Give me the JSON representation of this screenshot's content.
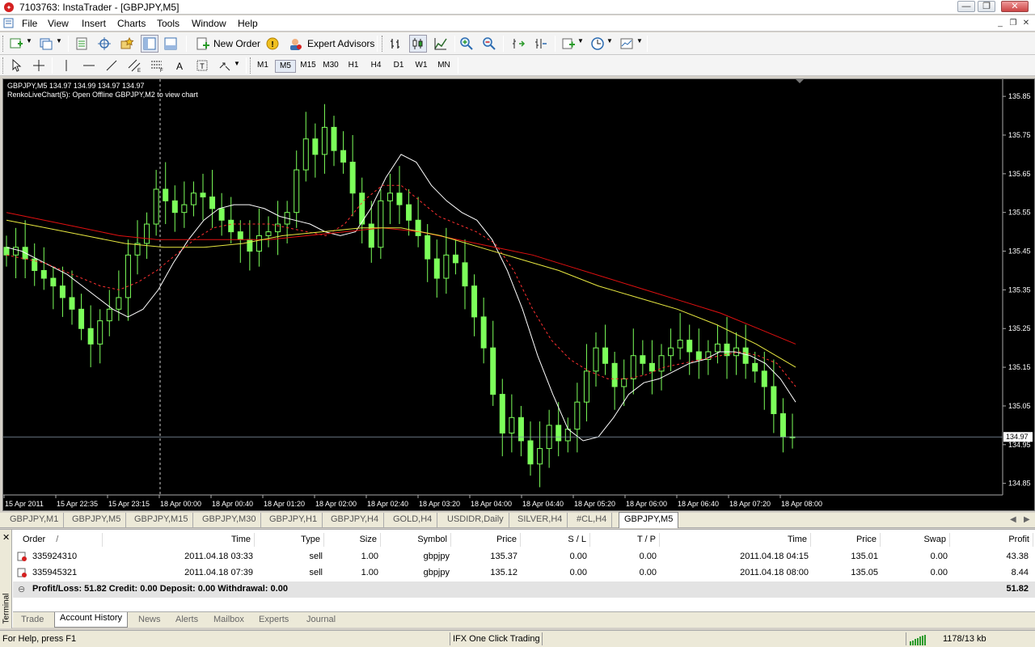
{
  "window": {
    "title": "7103763: InstaTrader - [GBPJPY,M5]",
    "min_label": "—",
    "max_label": "❐",
    "close_label": "✕"
  },
  "menu": [
    "File",
    "View",
    "Insert",
    "Charts",
    "Tools",
    "Window",
    "Help"
  ],
  "toolbar": {
    "new_order": "New Order",
    "expert_advisors": "Expert Advisors",
    "timeframes": [
      "M1",
      "M5",
      "M15",
      "M30",
      "H1",
      "H4",
      "D1",
      "W1",
      "MN"
    ]
  },
  "chart": {
    "header_line1": "GBPJPY,M5  134.97 134.99 134.97 134.97",
    "header_line2": "RenkoLiveChart(5): Open Offline GBPJPY,M2 to view chart",
    "current_price": "134.97",
    "colors": {
      "background": "#000000",
      "candle": "#7cff5a",
      "grid": "#ffffff",
      "ma_fast": "#ffffff",
      "ma_dash": "#ff3030",
      "ma_slow_red": "#e01010",
      "ma_slow_yellow": "#e8e840"
    }
  },
  "chart_data": {
    "type": "line",
    "symbol": "GBPJPY",
    "timeframe": "M5",
    "y_ticks": [
      "135.85",
      "135.75",
      "135.65",
      "135.55",
      "135.45",
      "135.35",
      "135.25",
      "135.15",
      "135.05",
      "134.95",
      "134.85"
    ],
    "x_ticks": [
      "15 Apr 2011",
      "15 Apr 22:35",
      "15 Apr 23:15",
      "18 Apr 00:00",
      "18 Apr 00:40",
      "18 Apr 01:20",
      "18 Apr 02:00",
      "18 Apr 02:40",
      "18 Apr 03:20",
      "18 Apr 04:00",
      "18 Apr 04:40",
      "18 Apr 05:20",
      "18 Apr 06:00",
      "18 Apr 06:40",
      "18 Apr 07:20",
      "18 Apr 08:00"
    ],
    "ylim": [
      134.82,
      135.89
    ],
    "close_series": [
      135.44,
      135.46,
      135.43,
      135.4,
      135.38,
      135.36,
      135.33,
      135.3,
      135.25,
      135.21,
      135.27,
      135.3,
      135.33,
      135.44,
      135.47,
      135.52,
      135.61,
      135.58,
      135.55,
      135.57,
      135.6,
      135.59,
      135.56,
      135.53,
      135.5,
      135.48,
      135.45,
      135.49,
      135.5,
      135.52,
      135.55,
      135.66,
      135.74,
      135.7,
      135.77,
      135.71,
      135.68,
      135.6,
      135.52,
      135.46,
      135.58,
      135.6,
      135.57,
      135.53,
      135.49,
      135.43,
      135.38,
      135.44,
      135.42,
      135.36,
      135.28,
      135.2,
      135.08,
      134.98,
      135.02,
      134.96,
      134.9,
      134.94,
      135.0,
      134.96,
      134.99,
      135.06,
      135.14,
      135.2,
      135.16,
      135.1,
      135.12,
      135.18,
      135.16,
      135.14,
      135.18,
      135.2,
      135.22,
      135.19,
      135.17,
      135.19,
      135.21,
      135.18,
      135.2,
      135.16,
      135.14,
      135.1,
      135.03,
      134.97,
      134.97
    ],
    "series": [
      {
        "name": "MA fast",
        "values": [
          135.46,
          135.45,
          135.43,
          135.41,
          135.39,
          135.36,
          135.33,
          135.3,
          135.28,
          135.3,
          135.35,
          135.42,
          135.48,
          135.53,
          135.56,
          135.57,
          135.57,
          135.56,
          135.54,
          135.53,
          135.52,
          135.5,
          135.49,
          135.5,
          135.56,
          135.64,
          135.7,
          135.68,
          135.62,
          135.58,
          135.55,
          135.53,
          135.48,
          135.4,
          135.3,
          135.18,
          135.08,
          134.99,
          134.96,
          134.97,
          135.02,
          135.08,
          135.11,
          135.12,
          135.14,
          135.16,
          135.17,
          135.19,
          135.19,
          135.18,
          135.16,
          135.12,
          135.06
        ]
      },
      {
        "name": "MA dashed",
        "values": [
          135.44,
          135.43,
          135.42,
          135.4,
          135.38,
          135.36,
          135.35,
          135.37,
          135.4,
          135.44,
          135.48,
          135.51,
          135.52,
          135.52,
          135.52,
          135.51,
          135.5,
          135.49,
          135.52,
          135.58,
          135.62,
          135.62,
          135.58,
          135.54,
          135.52,
          135.5,
          135.47,
          135.4,
          135.3,
          135.22,
          135.17,
          135.14,
          135.12,
          135.12,
          135.13,
          135.15,
          135.16,
          135.17,
          135.18,
          135.19,
          135.18,
          135.16,
          135.1
        ]
      },
      {
        "name": "MA slow red",
        "values": [
          135.55,
          135.53,
          135.51,
          135.49,
          135.48,
          135.48,
          135.48,
          135.48,
          135.49,
          135.5,
          135.51,
          135.5,
          135.48,
          135.46,
          135.44,
          135.41,
          135.38,
          135.35,
          135.32,
          135.29,
          135.25,
          135.21
        ]
      },
      {
        "name": "MA slow yellow",
        "values": [
          135.53,
          135.51,
          135.49,
          135.47,
          135.46,
          135.46,
          135.47,
          135.49,
          135.5,
          135.51,
          135.51,
          135.49,
          135.46,
          135.43,
          135.4,
          135.36,
          135.33,
          135.3,
          135.26,
          135.21,
          135.15
        ]
      }
    ]
  },
  "symbol_tabs": [
    "GBPJPY,M1",
    "GBPJPY,M5",
    "GBPJPY,M15",
    "GBPJPY,M30",
    "GBPJPY,H1",
    "GBPJPY,H4",
    "GOLD,H4",
    "USDIDR,Daily",
    "SILVER,H4",
    "#CL,H4",
    "GBPJPY,M5"
  ],
  "terminal": {
    "side_label": "Terminal",
    "close_label": "✕",
    "columns": [
      "Order",
      "/",
      "Time",
      "Type",
      "Size",
      "Symbol",
      "Price",
      "S / L",
      "T / P",
      "Time",
      "Price",
      "Swap",
      "Profit"
    ],
    "rows": [
      {
        "order": "335924310",
        "open_time": "2011.04.18 03:33",
        "type": "sell",
        "size": "1.00",
        "symbol": "gbpjpy",
        "open_price": "135.37",
        "sl": "0.00",
        "tp": "0.00",
        "close_time": "2011.04.18 04:15",
        "close_price": "135.01",
        "swap": "0.00",
        "profit": "43.38"
      },
      {
        "order": "335945321",
        "open_time": "2011.04.18 07:39",
        "type": "sell",
        "size": "1.00",
        "symbol": "gbpjpy",
        "open_price": "135.12",
        "sl": "0.00",
        "tp": "0.00",
        "close_time": "2011.04.18 08:00",
        "close_price": "135.05",
        "swap": "0.00",
        "profit": "8.44"
      }
    ],
    "summary": "Profit/Loss: 51.82  Credit: 0.00  Deposit: 0.00  Withdrawal: 0.00",
    "summary_total": "51.82",
    "tabs": [
      "Trade",
      "Account History",
      "News",
      "Alerts",
      "Mailbox",
      "Experts",
      "Journal"
    ]
  },
  "status": {
    "help": "For Help, press F1",
    "mode": "IFX One Click Trading",
    "traffic": "1178/13 kb"
  }
}
